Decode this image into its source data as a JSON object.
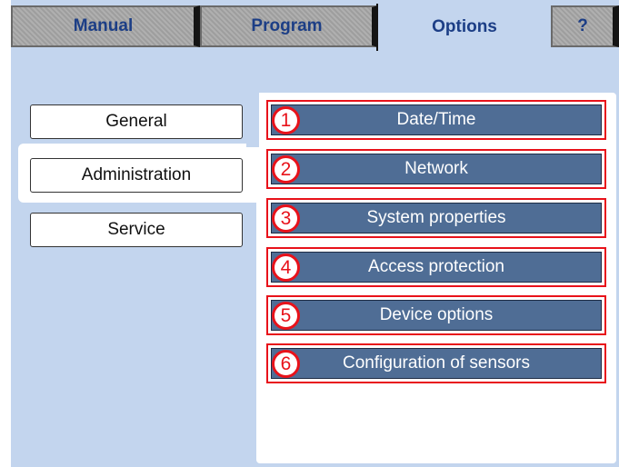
{
  "tabs": {
    "manual": "Manual",
    "program": "Program",
    "options": "Options",
    "help": "?"
  },
  "nav": {
    "general": "General",
    "administration": "Administration",
    "service": "Service"
  },
  "options": [
    {
      "number": "1",
      "label": "Date/Time"
    },
    {
      "number": "2",
      "label": "Network"
    },
    {
      "number": "3",
      "label": "System properties"
    },
    {
      "number": "4",
      "label": "Access protection"
    },
    {
      "number": "5",
      "label": "Device options"
    },
    {
      "number": "6",
      "label": "Configuration of sensors"
    }
  ],
  "colors": {
    "background": "#c3d5ee",
    "tab_text": "#1c3e86",
    "button_fill": "#4f6d95",
    "callout_red": "#e8121a"
  }
}
